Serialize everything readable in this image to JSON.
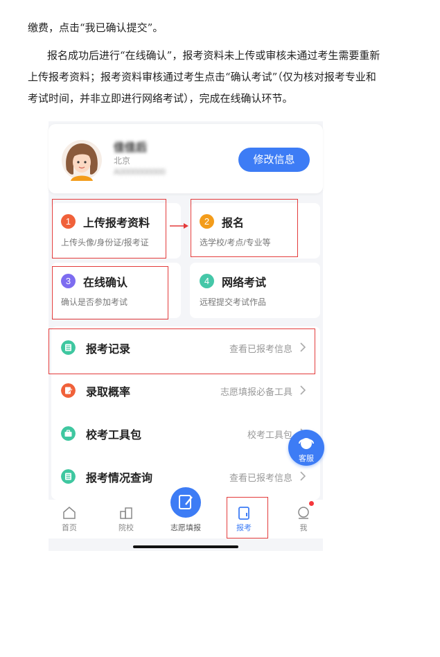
{
  "document": {
    "line1": "缴费，点击“我已确认提交”。",
    "line2": "报名成功后进行“在线确认”，报考资料未上传或审核未通过考生需要重新",
    "line3": "上传报考资料；报考资料审核通过考生点击“确认考试”（仅为核对报考专业和",
    "line4": "考试时间，并非立即进行网络考试），完成在线确认环节。"
  },
  "profile": {
    "name": "佳佳后",
    "region": "北京",
    "account": "A0000000000",
    "edit_button": "修改信息"
  },
  "steps": [
    {
      "num": "1",
      "title": "上传报考资料",
      "desc": "上传头像/身份证/报考证",
      "color": "#f0613a"
    },
    {
      "num": "2",
      "title": "报名",
      "desc": "选学校/考点/专业等",
      "color": "#f39c1a"
    },
    {
      "num": "3",
      "title": "在线确认",
      "desc": "确认是否参加考试",
      "color": "#7d6cf0"
    },
    {
      "num": "4",
      "title": "网络考试",
      "desc": "远程提交考试作品",
      "color": "#45c7a8"
    }
  ],
  "menu": [
    {
      "label": "报考记录",
      "hint": "查看已报考信息",
      "icon": "list-icon",
      "color": "#3fc7a0"
    },
    {
      "label": "录取概率",
      "hint": "志愿填报必备工具",
      "icon": "edit-doc-icon",
      "color": "#f0613a"
    },
    {
      "label": "校考工具包",
      "hint": "校考工具包",
      "icon": "briefcase-icon",
      "color": "#3fc7a0"
    },
    {
      "label": "报考情况查询",
      "hint": "查看已报考信息",
      "icon": "list-icon",
      "color": "#3fc7a0"
    }
  ],
  "service_label": "客服",
  "tabs": [
    {
      "label": "首页",
      "icon": "home-icon"
    },
    {
      "label": "院校",
      "icon": "school-icon"
    },
    {
      "label": "志愿填报",
      "icon": "pen-icon"
    },
    {
      "label": "报考",
      "icon": "exam-icon"
    },
    {
      "label": "我",
      "icon": "user-icon"
    }
  ],
  "colors": {
    "accent": "#3d7cf5",
    "annotation": "#e33a3a"
  }
}
